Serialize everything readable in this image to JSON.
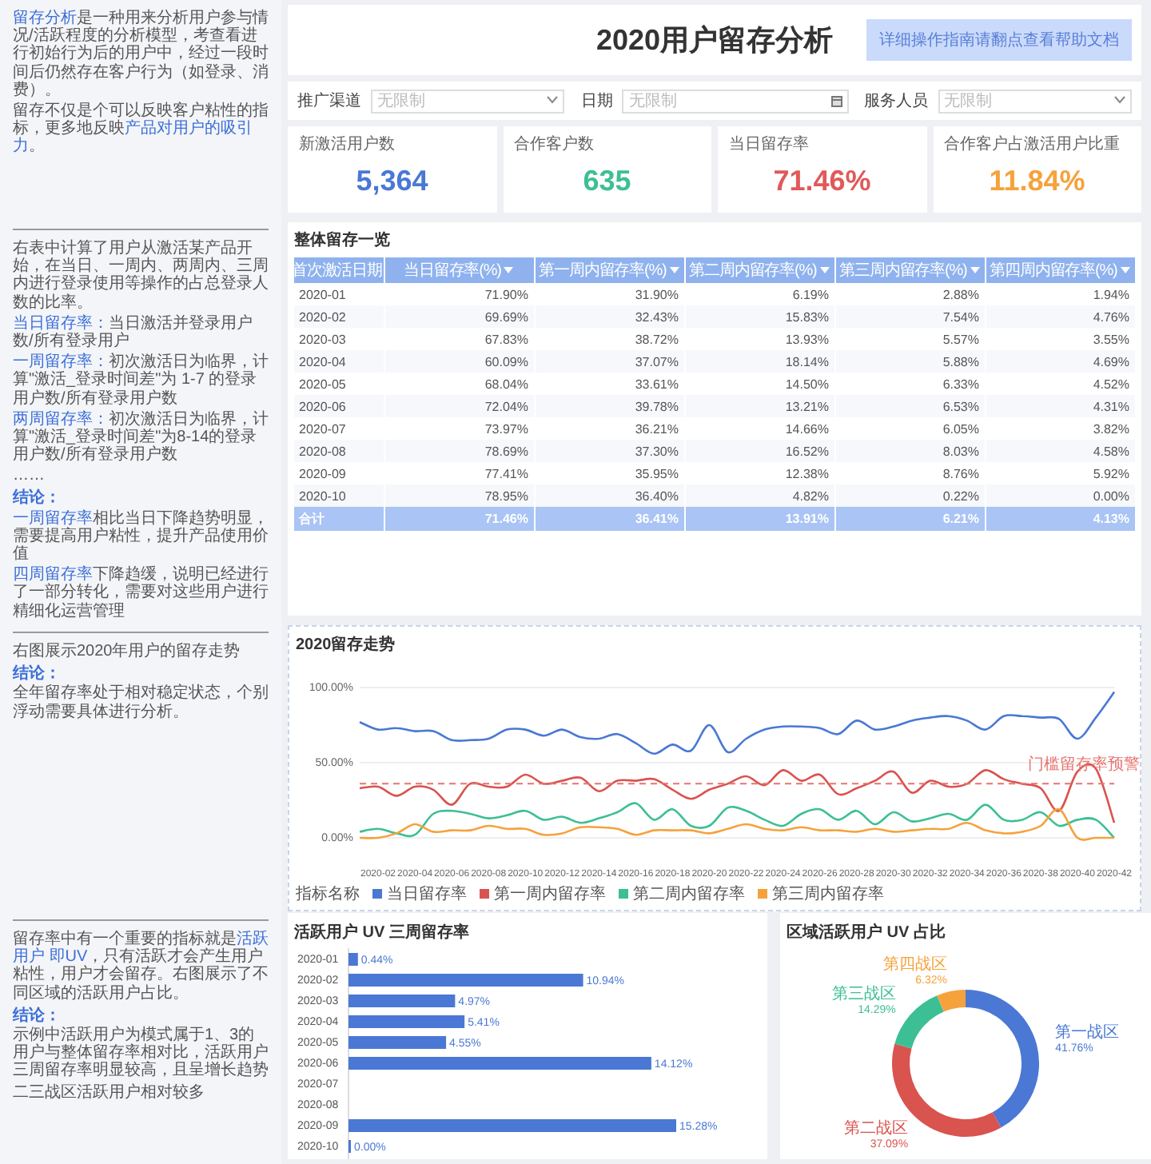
{
  "notes": [
    {
      "paragraphs": [
        {
          "kind": "text",
          "segments": [
            {
              "text": "留存分析",
              "highlight": true
            },
            {
              "text": "是一种用来分析用户参与情况/活跃程度的分析模型，考查看进行初始行为后的用户中，经过一段时间后仍然存在客户行为（如登录、消费）。",
              "highlight": false
            }
          ]
        },
        {
          "kind": "text",
          "segments": [
            {
              "text": "留存不仅是个可以反映客户粘性的指标，更多地反映",
              "highlight": false
            },
            {
              "text": "产品对用户的吸引力",
              "highlight": true
            },
            {
              "text": "。",
              "highlight": false
            }
          ]
        }
      ]
    },
    {
      "paragraphs": [
        {
          "kind": "text",
          "segments": [
            {
              "text": "右表中计算了用户从激活某产品开始，在当日、一周内、两周内、三周内进行登录使用等操作的占总登录人数的比率。",
              "highlight": false
            }
          ]
        },
        {
          "kind": "text",
          "segments": [
            {
              "text": "当日留存率：",
              "highlight": true
            },
            {
              "text": "当日激活并登录用户数/所有登录用户",
              "highlight": false
            }
          ]
        },
        {
          "kind": "text",
          "segments": [
            {
              "text": "一周留存率：",
              "highlight": true
            },
            {
              "text": "初次激活日为临界，计算\"激活_登录时间差\"为 1-7 的登录用户数/所有登录用户数",
              "highlight": false
            }
          ]
        },
        {
          "kind": "text",
          "segments": [
            {
              "text": "两周留存率：",
              "highlight": true
            },
            {
              "text": "初次激活日为临界，计算\"激活_登录时间差\"为8-14的登录用户数/所有登录用户数",
              "highlight": false
            }
          ]
        },
        {
          "kind": "text",
          "segments": [
            {
              "text": "……",
              "highlight": false
            }
          ]
        },
        {
          "kind": "heading",
          "segments": [
            {
              "text": "结论：",
              "highlight": true
            }
          ]
        },
        {
          "kind": "text",
          "segments": [
            {
              "text": "一周留存率",
              "highlight": true
            },
            {
              "text": "相比当日下降趋势明显，需要提高用户粘性，提升产品使用价值",
              "highlight": false
            }
          ]
        },
        {
          "kind": "text",
          "segments": [
            {
              "text": "四周留存率",
              "highlight": true
            },
            {
              "text": "下降趋缓，说明已经进行了一部分转化，需要对这些用户进行精细化运营管理",
              "highlight": false
            }
          ]
        }
      ]
    },
    {
      "paragraphs": [
        {
          "kind": "text",
          "segments": [
            {
              "text": "右图展示2020年用户的留存走势",
              "highlight": false
            }
          ]
        },
        {
          "kind": "heading",
          "segments": [
            {
              "text": "结论：",
              "highlight": true
            }
          ]
        },
        {
          "kind": "text",
          "segments": [
            {
              "text": "全年留存率处于相对稳定状态，个别浮动需要具体进行分析。",
              "highlight": false
            }
          ]
        }
      ]
    },
    {
      "paragraphs": [
        {
          "kind": "text",
          "segments": [
            {
              "text": "留存率中有一个重要的指标就是",
              "highlight": false
            },
            {
              "text": "活跃用户 即UV",
              "highlight": true
            },
            {
              "text": "，只有活跃才会产生用户粘性，用户才会留存。右图展示了不同区域的活跃用户占比。",
              "highlight": false
            }
          ]
        },
        {
          "kind": "heading",
          "segments": [
            {
              "text": "结论：",
              "highlight": true
            }
          ]
        },
        {
          "kind": "text",
          "segments": [
            {
              "text": "示例中活跃用户为模式属于1、3的用户与整体留存率相对比，活跃用户三周留存率明显较高，且呈增长趋势",
              "highlight": false
            }
          ]
        },
        {
          "kind": "text",
          "segments": [
            {
              "text": "二三战区活跃用户相对较多",
              "highlight": false
            }
          ]
        }
      ]
    }
  ],
  "header": {
    "title": "2020用户留存分析",
    "help_button": "详细操作指南请翻点查看帮助文档"
  },
  "filters": [
    {
      "label": "推广渠道",
      "placeholder": "无限制",
      "kind": "select"
    },
    {
      "label": "日期",
      "placeholder": "无限制",
      "kind": "date"
    },
    {
      "label": "服务人员",
      "placeholder": "无限制",
      "kind": "select"
    }
  ],
  "kpis": [
    {
      "label": "新激活用户数",
      "value": "5,364",
      "color": "#4a78d4"
    },
    {
      "label": "合作客户数",
      "value": "635",
      "color": "#3cbf94"
    },
    {
      "label": "当日留存率",
      "value": "71.46%",
      "color": "#e05a5a"
    },
    {
      "label": "合作客户占激活用户比重",
      "value": "11.84%",
      "color": "#f5a23c"
    }
  ],
  "retention_table": {
    "title": "整体留存一览",
    "columns": [
      {
        "label": "首次激活日期",
        "kind": "sortable"
      },
      {
        "label": "当日留存率(%)",
        "kind": "filter"
      },
      {
        "label": "第一周内留存率(%)",
        "kind": "filter"
      },
      {
        "label": "第二周内留存率(%)",
        "kind": "filter"
      },
      {
        "label": "第三周内留存率(%)",
        "kind": "filter"
      },
      {
        "label": "第四周内留存率(%)",
        "kind": "filter"
      }
    ],
    "rows": [
      [
        "2020-01",
        "71.90%",
        "31.90%",
        "6.19%",
        "2.88%",
        "1.94%"
      ],
      [
        "2020-02",
        "69.69%",
        "32.43%",
        "15.83%",
        "7.54%",
        "4.76%"
      ],
      [
        "2020-03",
        "67.83%",
        "38.72%",
        "13.93%",
        "5.57%",
        "3.55%"
      ],
      [
        "2020-04",
        "60.09%",
        "37.07%",
        "18.14%",
        "5.88%",
        "4.69%"
      ],
      [
        "2020-05",
        "68.04%",
        "33.61%",
        "14.50%",
        "6.33%",
        "4.52%"
      ],
      [
        "2020-06",
        "72.04%",
        "39.78%",
        "13.21%",
        "6.53%",
        "4.31%"
      ],
      [
        "2020-07",
        "73.97%",
        "36.21%",
        "14.66%",
        "6.05%",
        "3.82%"
      ],
      [
        "2020-08",
        "78.69%",
        "37.30%",
        "16.52%",
        "8.03%",
        "4.58%"
      ],
      [
        "2020-09",
        "77.41%",
        "35.95%",
        "12.38%",
        "8.76%",
        "5.92%"
      ],
      [
        "2020-10",
        "78.95%",
        "36.40%",
        "4.82%",
        "0.22%",
        "0.00%"
      ]
    ],
    "total": [
      "合计",
      "71.46%",
      "36.41%",
      "13.91%",
      "6.21%",
      "4.13%"
    ]
  },
  "trend_chart": {
    "title": "2020留存走势",
    "legend_title": "指标名称",
    "chart_data": {
      "type": "line",
      "categories": [
        null,
        "2020-02",
        null,
        "2020-04",
        null,
        "2020-06",
        null,
        "2020-08",
        null,
        "2020-10",
        null,
        "2020-12",
        null,
        "2020-14",
        null,
        "2020-16",
        null,
        "2020-18",
        null,
        "2020-20",
        null,
        "2020-22",
        null,
        "2020-24",
        null,
        "2020-26",
        null,
        "2020-28",
        null,
        "2020-30",
        null,
        "2020-32",
        null,
        "2020-34",
        null,
        "2020-36",
        null,
        "2020-38",
        null,
        "2020-40",
        null,
        "2020-42"
      ],
      "ylim": [
        0,
        100
      ],
      "yticks": [
        {
          "value": 0,
          "label": "0.00%"
        },
        {
          "value": 50,
          "label": "50.00%"
        },
        {
          "value": 100,
          "label": "100.00%"
        }
      ],
      "series": [
        {
          "name": "当日留存率",
          "color": "#4a78d4",
          "values": [
            77,
            72,
            73,
            71,
            71,
            65,
            65,
            66,
            72,
            72,
            68,
            72,
            67,
            66,
            69,
            63,
            56,
            62,
            58,
            75,
            57,
            66,
            72,
            74,
            74,
            73,
            69,
            78,
            72,
            74,
            78,
            80,
            81,
            78,
            72,
            81,
            81,
            80,
            79,
            66,
            80,
            97
          ]
        },
        {
          "name": "第一周内留存率",
          "color": "#d9534f",
          "values": [
            33,
            34,
            28,
            34,
            32,
            22,
            36,
            34,
            34,
            42,
            36,
            38,
            40,
            31,
            38,
            38,
            39,
            32,
            26,
            32,
            36,
            41,
            35,
            45,
            38,
            42,
            29,
            33,
            38,
            44,
            30,
            38,
            34,
            36,
            45,
            39,
            36,
            33,
            18,
            44,
            46,
            10
          ]
        },
        {
          "name": "第二周内留存率",
          "color": "#3cbf94",
          "values": [
            4,
            6,
            3,
            2,
            16,
            18,
            16,
            13,
            15,
            18,
            12,
            14,
            10,
            13,
            17,
            23,
            12,
            19,
            8,
            8,
            20,
            18,
            12,
            8,
            16,
            19,
            12,
            18,
            9,
            17,
            11,
            13,
            16,
            12,
            22,
            12,
            12,
            17,
            8,
            12,
            12,
            0
          ]
        },
        {
          "name": "第三周内留存率",
          "color": "#f5a23c",
          "values": [
            0,
            0,
            3,
            9,
            4,
            5,
            5,
            8,
            6,
            6,
            2,
            3,
            7,
            7,
            6,
            2,
            5,
            5,
            5,
            3,
            6,
            9,
            6,
            5,
            7,
            5,
            5,
            4,
            6,
            4,
            5,
            6,
            6,
            10,
            5,
            3,
            4,
            8,
            19,
            0,
            0,
            0
          ]
        },
        {
          "name": "门槛留存率预警",
          "color": "#e8736f",
          "line_style": "dashed",
          "values": [
            36,
            36,
            36,
            36,
            36,
            36,
            36,
            36,
            36,
            36,
            36,
            36,
            36,
            36,
            36,
            36,
            36,
            36,
            36,
            36,
            36,
            36,
            36,
            36,
            36,
            36,
            36,
            36,
            36,
            36,
            36,
            36,
            36,
            36,
            36,
            36,
            36,
            36,
            36,
            36,
            36,
            36
          ]
        }
      ]
    }
  },
  "bar_chart": {
    "title": "活跃用户 UV 三周留存率",
    "chart_data": {
      "type": "bar",
      "orientation": "horizontal",
      "color": "#4a78d4",
      "categories": [
        "2020-01",
        "2020-02",
        "2020-03",
        "2020-04",
        "2020-05",
        "2020-06",
        "2020-07",
        "2020-08",
        "2020-09",
        "2020-10"
      ],
      "values": [
        0.44,
        10.94,
        4.97,
        5.41,
        4.55,
        14.12,
        null,
        null,
        15.28,
        0.0
      ],
      "value_labels": [
        "0.44%",
        "10.94%",
        "4.97%",
        "5.41%",
        "4.55%",
        "14.12%",
        null,
        null,
        "15.28%",
        "0.00%"
      ]
    }
  },
  "donut_chart": {
    "title": "区域活跃用户 UV 占比",
    "chart_data": {
      "type": "donut",
      "categories": [
        "第一战区",
        "第二战区",
        "第三战区",
        "第四战区"
      ],
      "values": [
        41.76,
        37.09,
        14.29,
        6.32
      ],
      "value_labels": [
        "41.76%",
        "37.09%",
        "14.29%",
        "6.32%"
      ],
      "colors": [
        "#4a78d4",
        "#d9534f",
        "#3cbf94",
        "#f5a23c"
      ]
    }
  }
}
